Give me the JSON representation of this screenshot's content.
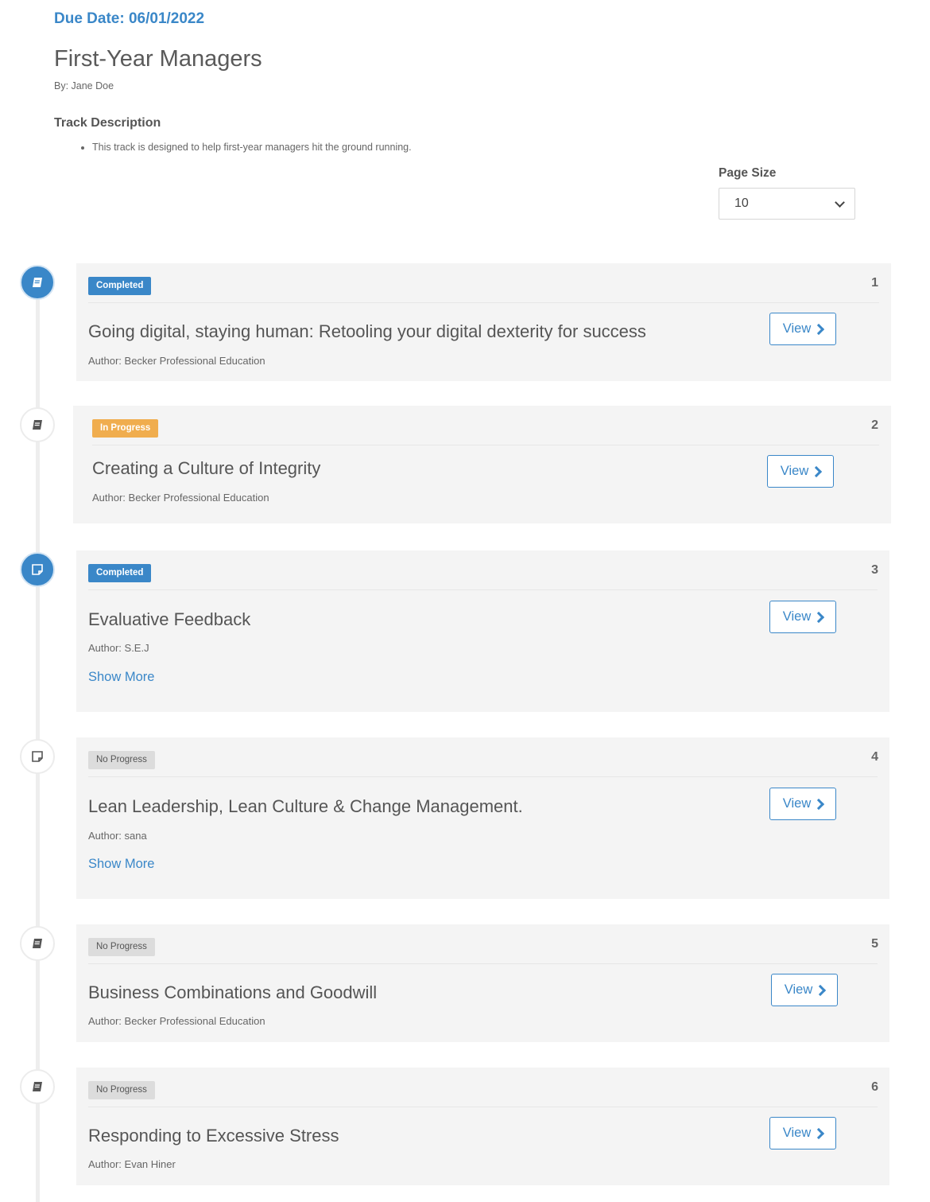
{
  "header": {
    "due_date": "Due Date: 06/01/2022",
    "title": "First-Year Managers",
    "byline": "By: Jane Doe",
    "description_heading": "Track Description",
    "description_items": [
      "This track is designed to help first-year managers hit the ground running."
    ]
  },
  "page_size": {
    "label": "Page Size",
    "selected": "10"
  },
  "items": [
    {
      "number": "1",
      "status": "Completed",
      "title": "Going digital, staying human: Retooling your digital dexterity for success",
      "author": "Author: Becker Professional Education",
      "view_label": "View",
      "icon": "book-icon"
    },
    {
      "number": "2",
      "status": "In Progress",
      "title": "Creating a Culture of Integrity",
      "author": "Author: Becker Professional Education",
      "view_label": "View",
      "icon": "book-icon"
    },
    {
      "number": "3",
      "status": "Completed",
      "title": "Evaluative Feedback",
      "author": "Author: S.E.J",
      "show_more": "Show More",
      "view_label": "View",
      "icon": "note-icon"
    },
    {
      "number": "4",
      "status": "No Progress",
      "title": "Lean Leadership, Lean Culture & Change Management.",
      "author": "Author: sana",
      "show_more": "Show More",
      "view_label": "View",
      "icon": "note-icon"
    },
    {
      "number": "5",
      "status": "No Progress",
      "title": "Business Combinations and Goodwill",
      "author": "Author: Becker Professional Education",
      "view_label": "View",
      "icon": "book-icon"
    },
    {
      "number": "6",
      "status": "No Progress",
      "title": "Responding to Excessive Stress",
      "author": "Author: Evan Hiner",
      "view_label": "View",
      "icon": "book-icon"
    }
  ],
  "colors": {
    "accent": "#3a87c8",
    "in_progress": "#f0ad4e",
    "no_progress": "#dcdcdc",
    "card_bg": "#f4f4f4"
  }
}
